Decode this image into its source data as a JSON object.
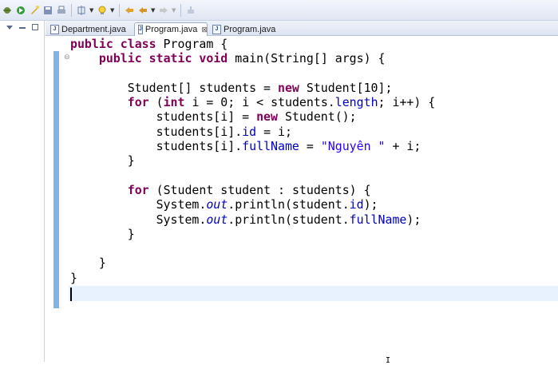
{
  "toolbar": {
    "icons": [
      "debug-icon",
      "run-icon",
      "new-icon",
      "save-icon",
      "print-icon",
      "lightbulb-icon",
      "back-icon",
      "forward-icon",
      "pin-icon"
    ]
  },
  "tabs": [
    {
      "label": "Department.java",
      "active": false
    },
    {
      "label": "Program.java",
      "active": true,
      "close": "⊠"
    },
    {
      "label": "Program.java",
      "active": false
    }
  ],
  "editor": {
    "lines": [
      [
        {
          "t": "public",
          "c": "kw"
        },
        {
          "t": " "
        },
        {
          "t": "class",
          "c": "kw"
        },
        {
          "t": " Program {"
        }
      ],
      [
        {
          "t": "    "
        },
        {
          "t": "public",
          "c": "kw"
        },
        {
          "t": " "
        },
        {
          "t": "static",
          "c": "kw"
        },
        {
          "t": " "
        },
        {
          "t": "void",
          "c": "kw"
        },
        {
          "t": " main(String[] args) {"
        }
      ],
      [],
      [
        {
          "t": "        Student[] students = "
        },
        {
          "t": "new",
          "c": "kw"
        },
        {
          "t": " Student[10];"
        }
      ],
      [
        {
          "t": "        "
        },
        {
          "t": "for",
          "c": "kw"
        },
        {
          "t": " ("
        },
        {
          "t": "int",
          "c": "kw"
        },
        {
          "t": " i = 0; i < students."
        },
        {
          "t": "length",
          "c": "fld"
        },
        {
          "t": "; i++) {"
        }
      ],
      [
        {
          "t": "            students[i] = "
        },
        {
          "t": "new",
          "c": "kw"
        },
        {
          "t": " Student();"
        }
      ],
      [
        {
          "t": "            students[i]."
        },
        {
          "t": "id",
          "c": "fld"
        },
        {
          "t": " = i;"
        }
      ],
      [
        {
          "t": "            students[i]."
        },
        {
          "t": "fullName",
          "c": "fld"
        },
        {
          "t": " = "
        },
        {
          "t": "\"Nguyên \"",
          "c": "str"
        },
        {
          "t": " + i;"
        }
      ],
      [
        {
          "t": "        }"
        }
      ],
      [],
      [
        {
          "t": "        "
        },
        {
          "t": "for",
          "c": "kw"
        },
        {
          "t": " (Student student : students) {"
        }
      ],
      [
        {
          "t": "            System."
        },
        {
          "t": "out",
          "c": "stat"
        },
        {
          "t": ".println(student."
        },
        {
          "t": "id",
          "c": "fld"
        },
        {
          "t": ");"
        }
      ],
      [
        {
          "t": "            System."
        },
        {
          "t": "out",
          "c": "stat"
        },
        {
          "t": ".println(student."
        },
        {
          "t": "fullName",
          "c": "fld"
        },
        {
          "t": ");"
        }
      ],
      [
        {
          "t": "        }"
        }
      ],
      [],
      [
        {
          "t": "    }"
        }
      ],
      [
        {
          "t": "}"
        }
      ],
      []
    ]
  },
  "colors": {
    "keyword": "#7f0055",
    "field": "#0000c0",
    "string": "#2a00ff",
    "current_line": "#e8f2fe",
    "change_bar": "#7fb4e6"
  }
}
